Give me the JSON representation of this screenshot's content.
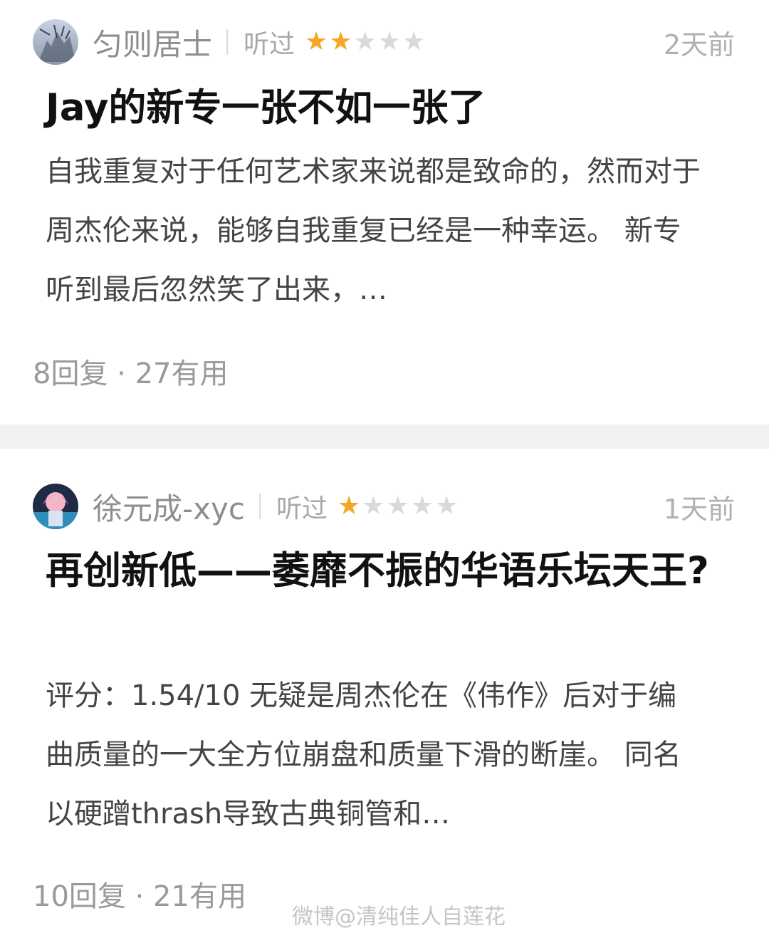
{
  "reviews": [
    {
      "username": "匀则居士",
      "status": "听过",
      "rating": 2,
      "max_rating": 5,
      "time": "2天前",
      "title": "Jay的新专一张不如一张了",
      "body": "自我重复对于任何艺术家来说都是致命的，然而对于周杰伦来说，能够自我重复已经是一种幸运。 新专听到最后忽然笑了出来，…",
      "stats": "8回复 · 27有用"
    },
    {
      "username": "徐元成-xyc",
      "status": "听过",
      "rating": 1,
      "max_rating": 5,
      "time": "1天前",
      "title": "再创新低——萎靡不振的华语乐坛天王?",
      "body": "评分：1.54/10 无疑是周杰伦在《伟作》后对于编曲质量的一大全方位崩盘和质量下滑的断崖。 同名以硬蹭thrash导致古典铜管和…",
      "stats": "10回复 · 21有用"
    }
  ],
  "watermark": "微博@清纯佳人自莲花",
  "colors": {
    "star_on": "#f5a623",
    "star_off": "#d9d9d9",
    "separator": "#f2f2f2"
  }
}
